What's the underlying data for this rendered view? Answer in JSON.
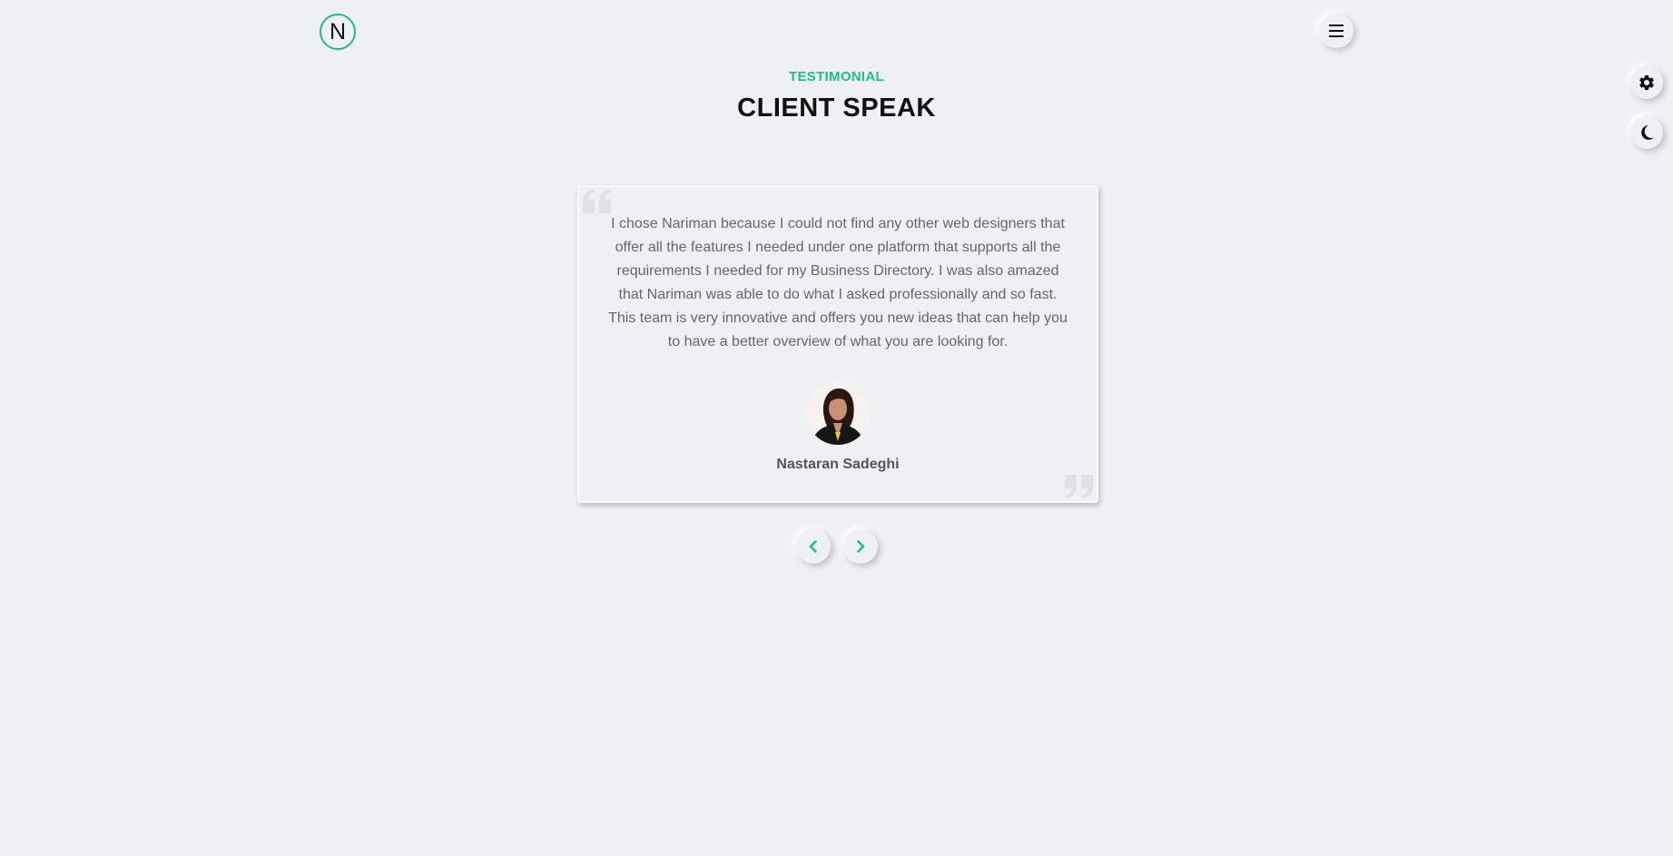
{
  "header": {
    "logo_letter": "N",
    "menu_icon": "hamburger-icon"
  },
  "side_controls": {
    "settings_icon": "gear-icon",
    "theme_icon": "moon-icon"
  },
  "section": {
    "label": "TESTIMONIAL",
    "title": "CLIENT SPEAK"
  },
  "testimonial": {
    "quote": "I chose Nariman because I could not find any other web designers that offer all the features I needed under one platform that supports all the requirements I needed for my Business Directory. I was also amazed that Nariman was able to do what I asked professionally and so fast. This team is very innovative and offers you new ideas that can help you to have a better overview of what you are looking for.",
    "client_name": "Nastaran Sadeghi"
  },
  "carousel": {
    "prev_icon": "chevron-left-icon",
    "next_icon": "chevron-right-icon"
  },
  "colors": {
    "accent": "#19c08a",
    "background": "#eef0f4"
  }
}
